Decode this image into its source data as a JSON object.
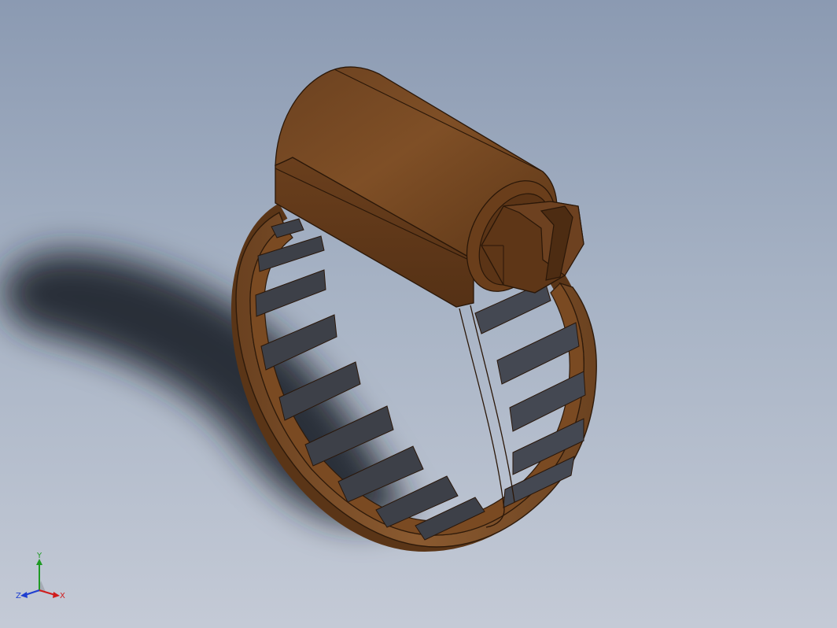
{
  "viewport": {
    "background_top": "#8b9ab2",
    "background_bottom": "#c4cad6"
  },
  "model": {
    "part": "hose-clamp",
    "color": "#7a4a22",
    "shade_color": "#5a3518",
    "highlight_color": "#8d5a2c"
  },
  "triad": {
    "x_label": "X",
    "y_label": "Y",
    "z_label": "Z",
    "x_color": "#d01c1c",
    "y_color": "#1f9a24",
    "z_color": "#1f3fd0"
  }
}
